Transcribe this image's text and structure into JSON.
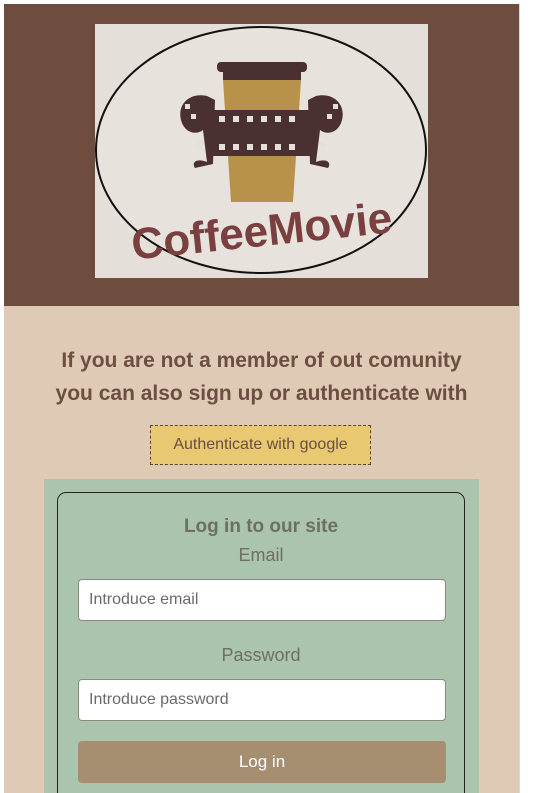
{
  "brand": {
    "logo_text": "CoffeeMovie",
    "colors": {
      "header": "#6e4d3f",
      "page": "#dfcab6",
      "login_section": "#abc4ad",
      "google_button": "#e8c870",
      "login_button": "#a68f70"
    }
  },
  "signup": {
    "tagline_line1": "If you are not a member of out comunity",
    "tagline_line2": "you can also sign up or authenticate with",
    "google_button_label": "Authenticate with google"
  },
  "login": {
    "title": "Log in to our site",
    "email_label": "Email",
    "email_placeholder": "Introduce email",
    "password_label": "Password",
    "password_placeholder": "Introduce password",
    "submit_label": "Log in"
  }
}
